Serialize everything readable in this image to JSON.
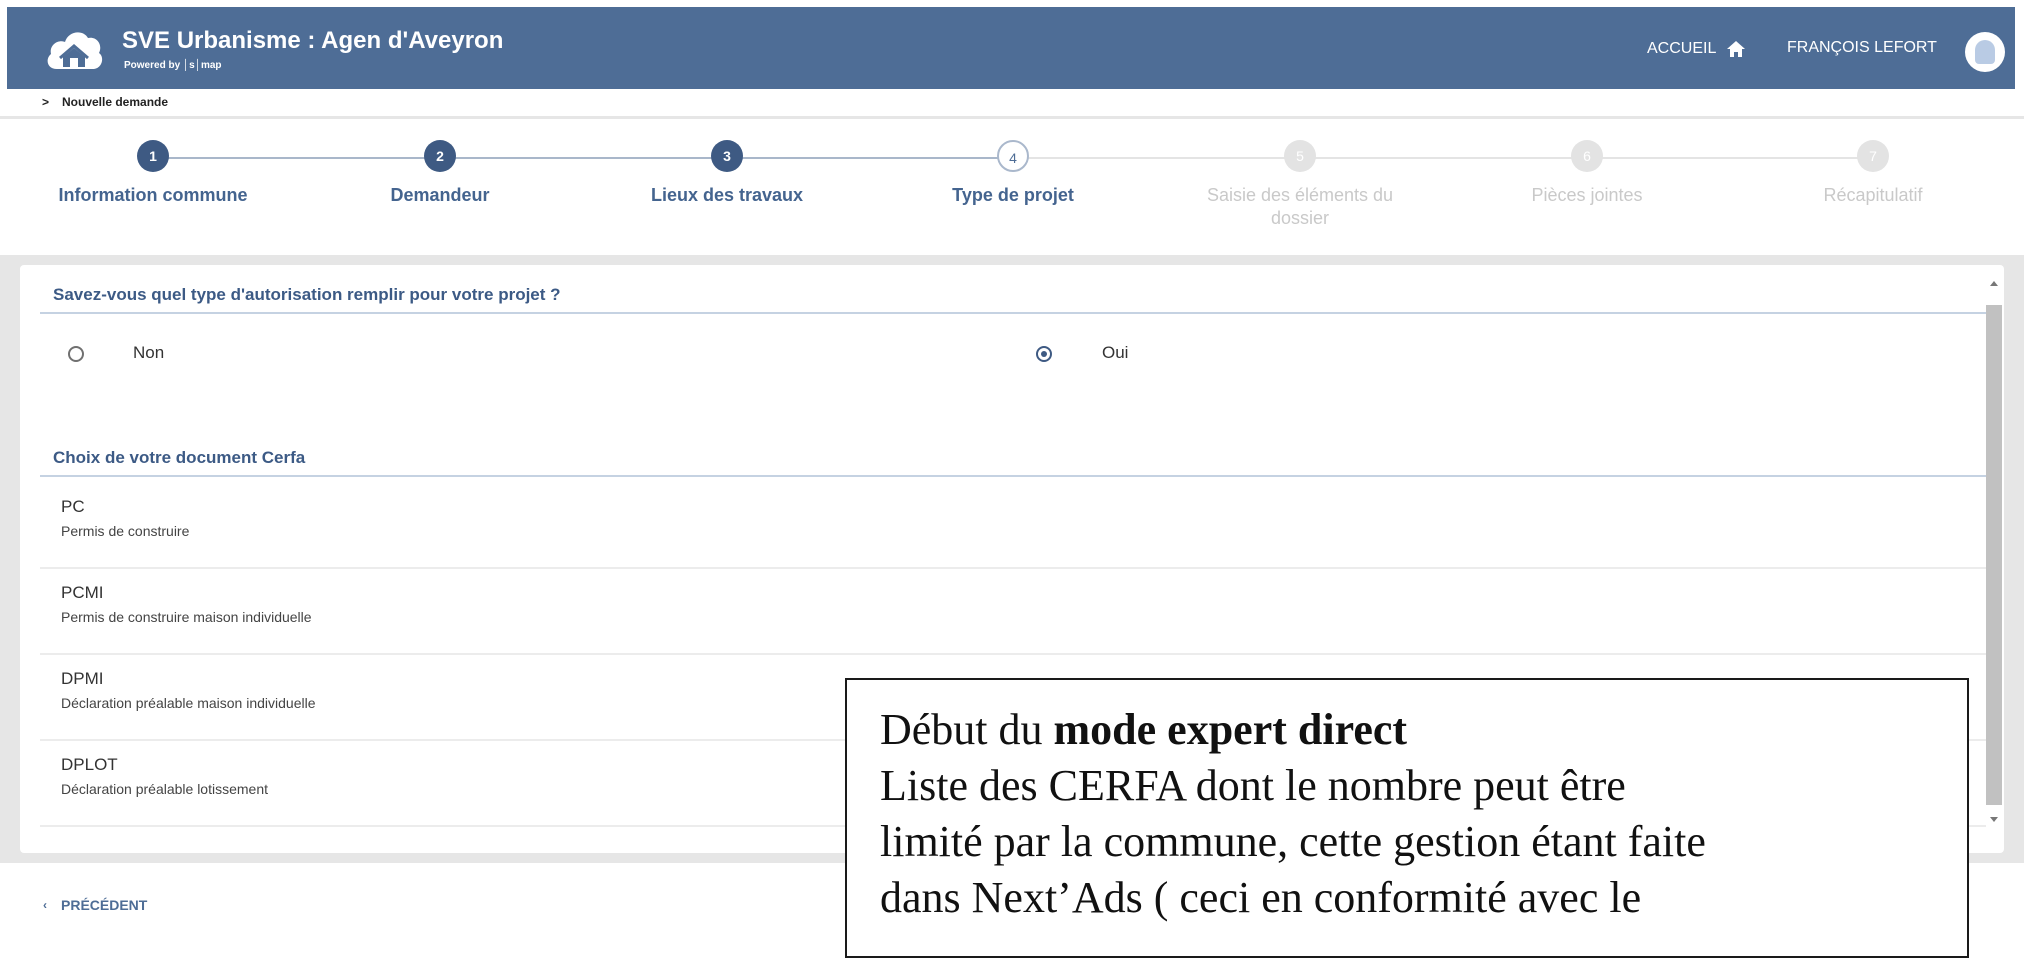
{
  "header": {
    "app_title": "SVE Urbanisme : Agen d'Aveyron",
    "powered_by": "Powered by │s│map",
    "nav_home": "ACCUEIL",
    "nav_user": "FRANÇOIS LEFORT",
    "background_color": "#4e6d96"
  },
  "breadcrumb": {
    "separator": ">",
    "item": "Nouvelle demande"
  },
  "steps": [
    {
      "number": "1",
      "label": "Information commune",
      "state": "done"
    },
    {
      "number": "2",
      "label": "Demandeur",
      "state": "done"
    },
    {
      "number": "3",
      "label": "Lieux des travaux",
      "state": "done"
    },
    {
      "number": "4",
      "label": "Type de projet",
      "state": "current"
    },
    {
      "number": "5",
      "label": "Saisie des éléments du dossier",
      "state": "todo"
    },
    {
      "number": "6",
      "label": "Pièces jointes",
      "state": "todo"
    },
    {
      "number": "7",
      "label": "Récapitulatif",
      "state": "todo"
    }
  ],
  "question": {
    "title": "Savez-vous quel type d'autorisation remplir pour votre projet ?",
    "option_no": "Non",
    "option_yes": "Oui",
    "selected": "Oui"
  },
  "cerfa": {
    "title": "Choix de votre document Cerfa",
    "items": [
      {
        "code": "PC",
        "description": "Permis de construire"
      },
      {
        "code": "PCMI",
        "description": "Permis de construire maison individuelle"
      },
      {
        "code": "DPMI",
        "description": "Déclaration préalable maison individuelle"
      },
      {
        "code": "DPLOT",
        "description": "Déclaration préalable lotissement"
      }
    ]
  },
  "footer": {
    "prev_chevron": "‹",
    "prev_label": "PRÉCÉDENT"
  },
  "annotation": {
    "line1_prefix": "Début du ",
    "line1_bold": "mode expert direct",
    "line2": "Liste des CERFA dont le nombre peut être",
    "line3": "limité par la commune, cette gestion étant faite",
    "line4": "dans Next’Ads ( ceci en  conformité avec le"
  },
  "colors": {
    "accent": "#3c5a85",
    "inactive_step": "#c9c9c9"
  }
}
